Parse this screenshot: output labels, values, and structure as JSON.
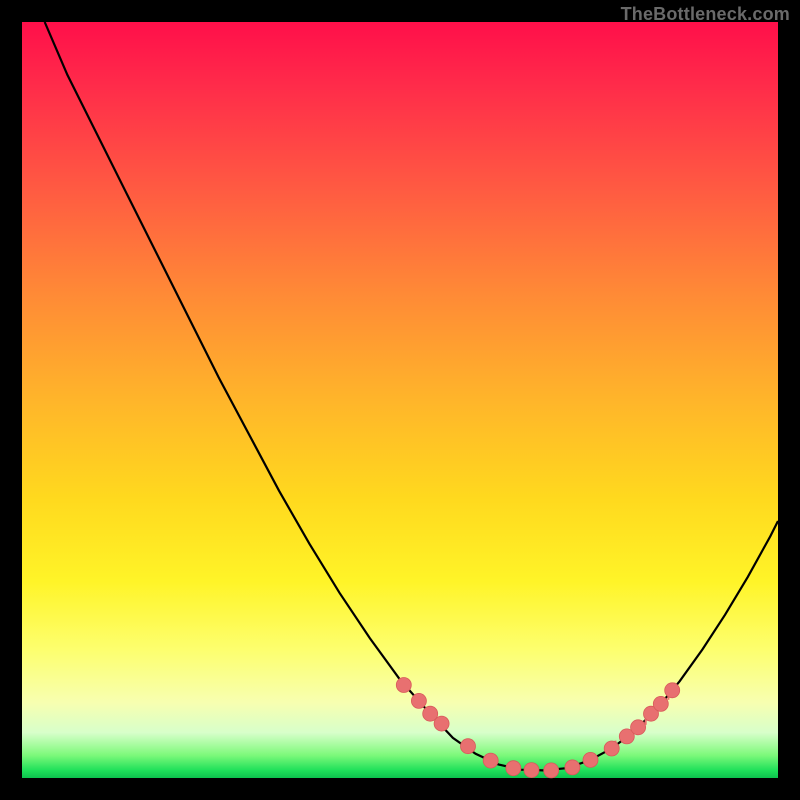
{
  "watermark": "TheBottleneck.com",
  "colors": {
    "frame": "#000000",
    "curve_stroke": "#000000",
    "marker_fill": "#e87070",
    "marker_stroke": "#d85a5a"
  },
  "chart_data": {
    "type": "line",
    "title": "",
    "xlabel": "",
    "ylabel": "",
    "xlim": [
      0,
      100
    ],
    "ylim": [
      0,
      100
    ],
    "grid": false,
    "legend": false,
    "series": [
      {
        "name": "curve",
        "x": [
          3,
          6,
          10,
          14,
          18,
          22,
          26,
          30,
          34,
          38,
          42,
          46,
          50,
          54,
          57,
          60,
          63,
          66,
          69,
          72,
          75,
          78,
          81,
          84,
          87,
          90,
          93,
          96,
          99,
          100
        ],
        "y": [
          100,
          93,
          85,
          77,
          69,
          61,
          53,
          45.5,
          38,
          31,
          24.5,
          18.5,
          13,
          8.5,
          5.3,
          3.2,
          1.8,
          1.1,
          1.0,
          1.3,
          2.3,
          3.9,
          6.2,
          9.2,
          12.8,
          17.0,
          21.6,
          26.6,
          32.0,
          34.0
        ]
      }
    ],
    "markers": {
      "name": "highlighted-points",
      "x": [
        50.5,
        52.5,
        54.0,
        55.5,
        59.0,
        62.0,
        65.0,
        67.4,
        70.0,
        72.8,
        75.2,
        78.0,
        80.0,
        81.5,
        83.2,
        84.5,
        86.0
      ],
      "y": [
        12.3,
        10.2,
        8.5,
        7.2,
        4.2,
        2.3,
        1.3,
        1.05,
        1.0,
        1.4,
        2.4,
        3.9,
        5.5,
        6.7,
        8.5,
        9.8,
        11.6
      ]
    }
  }
}
